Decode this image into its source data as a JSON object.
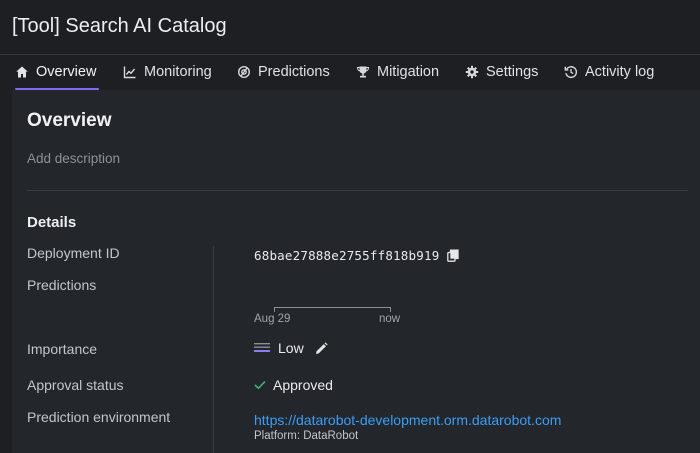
{
  "header": {
    "title": "[Tool] Search AI Catalog"
  },
  "tabs": [
    {
      "label": "Overview",
      "icon": "home-icon",
      "active": true
    },
    {
      "label": "Monitoring",
      "icon": "line-chart-icon"
    },
    {
      "label": "Predictions",
      "icon": "predictions-icon"
    },
    {
      "label": "Mitigation",
      "icon": "trophy-icon"
    },
    {
      "label": "Settings",
      "icon": "gear-icon"
    },
    {
      "label": "Activity log",
      "icon": "history-icon"
    }
  ],
  "overview": {
    "title": "Overview",
    "description_placeholder": "Add description",
    "details_title": "Details",
    "fields": {
      "deployment_id": {
        "label": "Deployment ID",
        "value": "68bae27888e2755ff818b919",
        "icon": "copy-icon"
      },
      "predictions": {
        "label": "Predictions",
        "axis_start": "Aug 29",
        "axis_end": "now"
      },
      "importance": {
        "label": "Importance",
        "value": "Low",
        "icon": "importance-low-icon",
        "edit_icon": "pencil-icon"
      },
      "approval_status": {
        "label": "Approval status",
        "value": "Approved",
        "icon": "check-icon"
      },
      "prediction_environment": {
        "label": "Prediction environment",
        "url": "https://datarobot-development.orm.datarobot.com",
        "platform": "Platform: DataRobot"
      }
    }
  },
  "colors": {
    "background": "#1d1f23",
    "panel": "#23262b",
    "accent": "#7c6ef2",
    "link": "#3a9ef5",
    "success": "#3fb27f"
  }
}
